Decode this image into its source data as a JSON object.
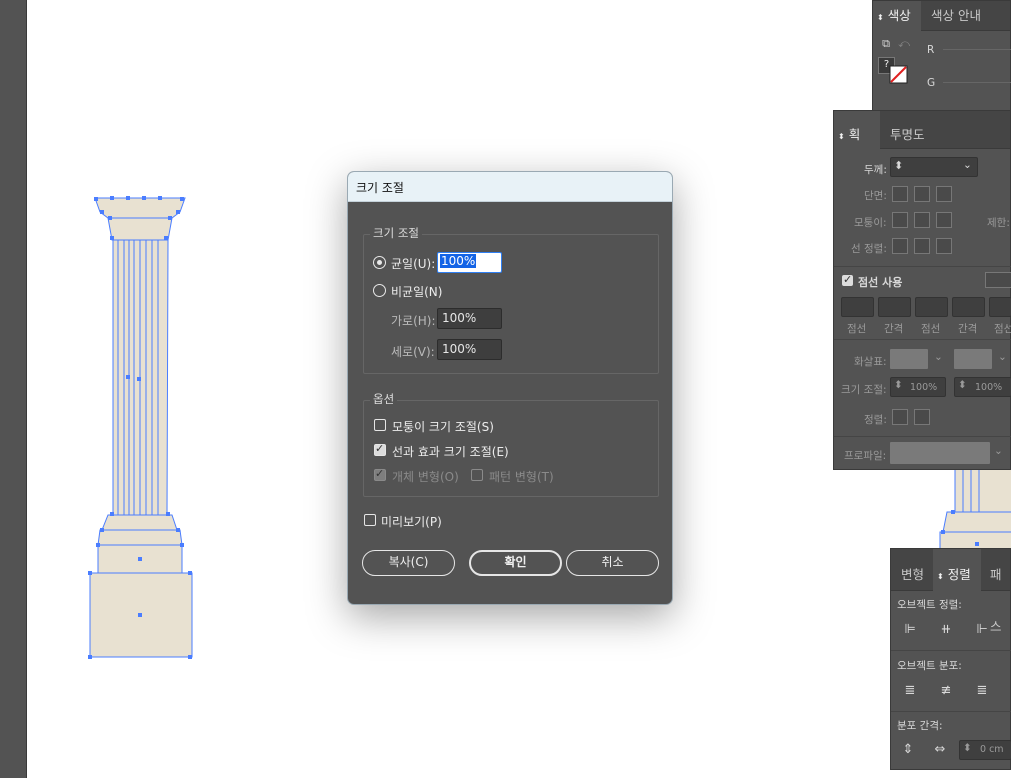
{
  "dialog": {
    "title": "크기 조절",
    "scale_group": {
      "label": "크기 조절",
      "uniform_label": "균일(U):",
      "uniform_value": "100%",
      "nonuniform_label": "비균일(N)",
      "horizontal_label": "가로(H):",
      "horizontal_value": "100%",
      "vertical_label": "세로(V):",
      "vertical_value": "100%"
    },
    "options_group": {
      "label": "옵션",
      "scale_corners": "모퉁이 크기 조절(S)",
      "scale_strokes": "선과 효과 크기 조절(E)",
      "transform_objects": "개체 변형(O)",
      "transform_patterns": "패턴 변형(T)"
    },
    "preview": "미리보기(P)",
    "copy_button": "복사(C)",
    "ok_button": "확인",
    "cancel_button": "취소"
  },
  "color_panel": {
    "tabs": [
      "색상",
      "색상 안내"
    ],
    "channel_r": "R",
    "channel_g": "G",
    "unknown": "?"
  },
  "stroke_panel": {
    "tabs": [
      "획",
      "투명도"
    ],
    "weight_label": "두께:",
    "cap_label": "단면:",
    "corner_label": "모퉁이:",
    "limit_label": "제한:",
    "align_label": "선 정렬:",
    "dashed_label": "점선 사용",
    "dash_headers": [
      "점선",
      "간격",
      "점선",
      "간격",
      "점선"
    ],
    "arrowheads_label": "화살표:",
    "scale_label": "크기 조절:",
    "scale_value_1": "100%",
    "scale_value_2": "100%",
    "align_arrow_label": "정렬:",
    "profile_label": "프로파일:"
  },
  "align_panel": {
    "tabs": [
      "변형",
      "정렬",
      "패스"
    ],
    "align_objects_label": "오브젝트 정렬:",
    "distribute_objects_label": "오브젝트 분포:",
    "distribute_spacing_label": "분포 간격:",
    "spacing_value": "0 cm"
  },
  "colors": {
    "panel_bg": "#535353",
    "selection_blue": "#4a7dff",
    "column_fill": "#e8e1d1",
    "dialog_title_bg": "#e8f2f7"
  }
}
